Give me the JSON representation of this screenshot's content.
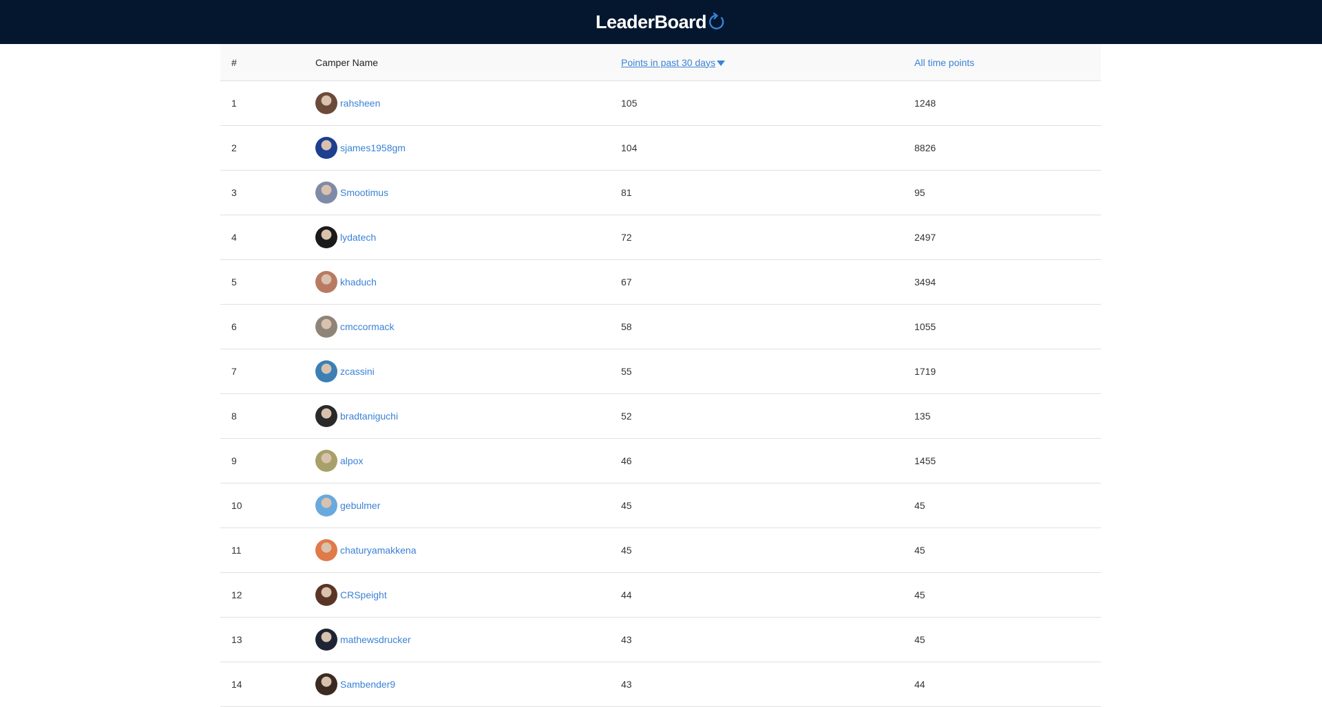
{
  "header": {
    "title": "LeaderBoard"
  },
  "table": {
    "columns": {
      "rank": "#",
      "name": "Camper Name",
      "recent": "Points in past 30 days",
      "alltime": "All time points"
    },
    "rows": [
      {
        "rank": "1",
        "name": "rahsheen",
        "recent": "105",
        "alltime": "1248",
        "avatar_color": "#6b4a3a"
      },
      {
        "rank": "2",
        "name": "sjames1958gm",
        "recent": "104",
        "alltime": "8826",
        "avatar_color": "#1c3f8f"
      },
      {
        "rank": "3",
        "name": "Smootimus",
        "recent": "81",
        "alltime": "95",
        "avatar_color": "#7f8aa6"
      },
      {
        "rank": "4",
        "name": "lydatech",
        "recent": "72",
        "alltime": "2497",
        "avatar_color": "#1a1a1a"
      },
      {
        "rank": "5",
        "name": "khaduch",
        "recent": "67",
        "alltime": "3494",
        "avatar_color": "#b97a63"
      },
      {
        "rank": "6",
        "name": "cmccormack",
        "recent": "58",
        "alltime": "1055",
        "avatar_color": "#8f8478"
      },
      {
        "rank": "7",
        "name": "zcassini",
        "recent": "55",
        "alltime": "1719",
        "avatar_color": "#3b7fb5"
      },
      {
        "rank": "8",
        "name": "bradtaniguchi",
        "recent": "52",
        "alltime": "135",
        "avatar_color": "#2a2a2a"
      },
      {
        "rank": "9",
        "name": "alpox",
        "recent": "46",
        "alltime": "1455",
        "avatar_color": "#a8a06a"
      },
      {
        "rank": "10",
        "name": "gebulmer",
        "recent": "45",
        "alltime": "45",
        "avatar_color": "#6aa9dd"
      },
      {
        "rank": "11",
        "name": "chaturyamakkena",
        "recent": "45",
        "alltime": "45",
        "avatar_color": "#e07a4a"
      },
      {
        "rank": "12",
        "name": "CRSpeight",
        "recent": "44",
        "alltime": "45",
        "avatar_color": "#5a3526"
      },
      {
        "rank": "13",
        "name": "mathewsdrucker",
        "recent": "43",
        "alltime": "45",
        "avatar_color": "#1e2433"
      },
      {
        "rank": "14",
        "name": "Sambender9",
        "recent": "43",
        "alltime": "44",
        "avatar_color": "#3a2a22"
      }
    ]
  },
  "colors": {
    "header_bg": "#04172f",
    "link": "#3b82d6",
    "refresh_icon": "#3b82d6"
  },
  "icons": {
    "refresh": "refresh-icon",
    "sort": "sort-desc-icon"
  }
}
